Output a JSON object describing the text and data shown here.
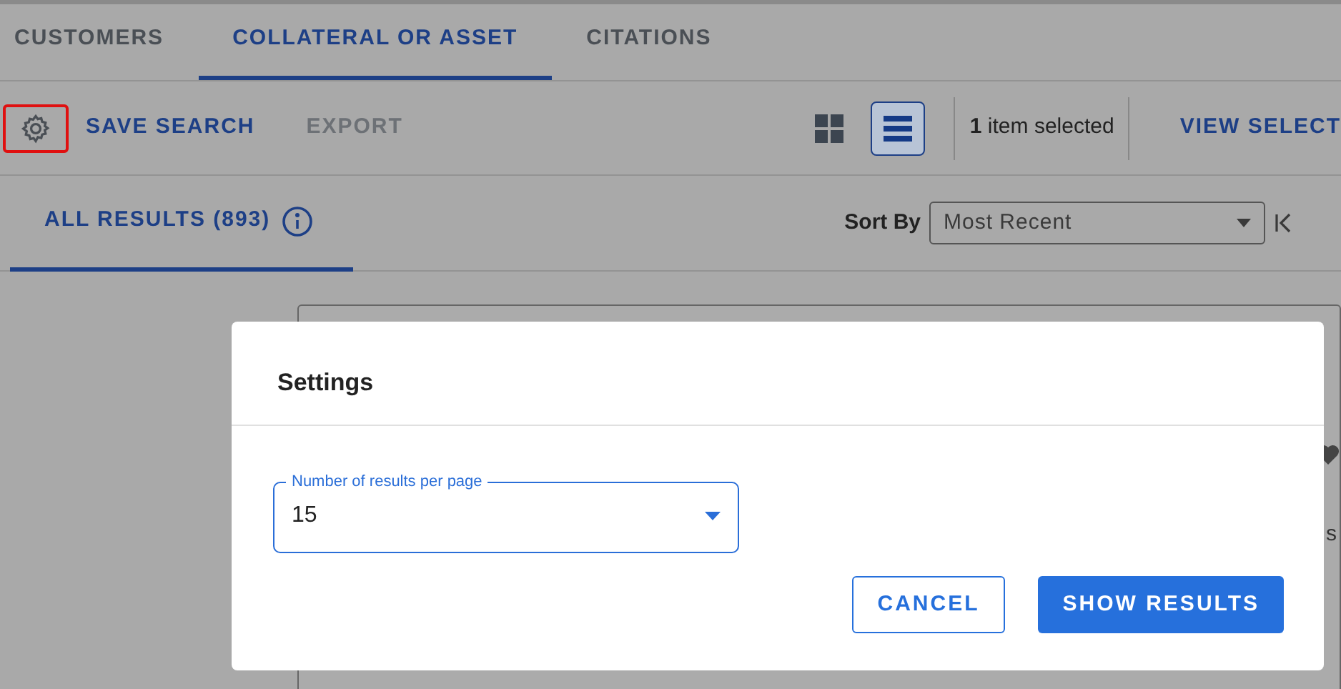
{
  "tabs": [
    {
      "label": "CUSTOMERS",
      "selected": false
    },
    {
      "label": "COLLATERAL OR ASSET",
      "selected": true
    },
    {
      "label": "CITATIONS",
      "selected": false
    }
  ],
  "toolbar": {
    "settings_highlighted": true,
    "actions": [
      {
        "label": "SAVE SEARCH",
        "disabled": false
      },
      {
        "label": "EXPORT",
        "disabled": true
      }
    ],
    "views": [
      {
        "kind": "grid",
        "selected": false
      },
      {
        "kind": "list",
        "selected": true
      }
    ],
    "selection": "**1** item selected",
    "view_selected": "VIEW SELECT"
  },
  "results": {
    "tabs": [
      {
        "label": "ALL RESULTS (893)",
        "selected": true
      }
    ],
    "sort_label": "Sort By",
    "sort_value": "Most Recent"
  },
  "card": {
    "text": "s"
  },
  "dialog": {
    "title": "Settings",
    "field": {
      "label": "Number of results per page",
      "value": "15"
    },
    "buttons": [
      {
        "label": "CANCEL",
        "kind": "secondary"
      },
      {
        "label": "SHOW RESULTS",
        "kind": "primary"
      }
    ]
  }
}
